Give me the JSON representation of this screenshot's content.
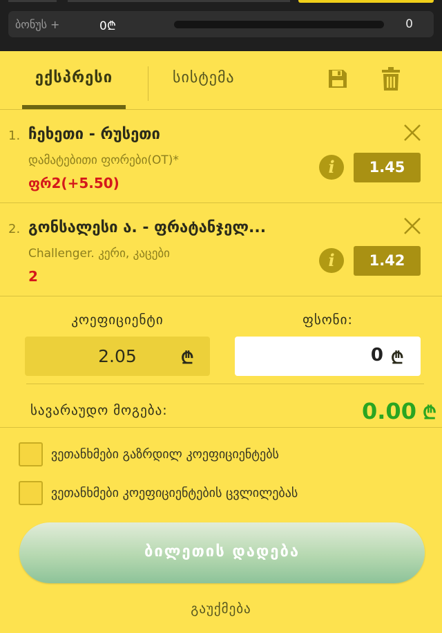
{
  "header": {
    "bonus_label": "ბონუს +",
    "bonus_amount": "0₾",
    "bonus_count": "0"
  },
  "tabs": [
    {
      "label": "ექსპრესი",
      "active": true
    },
    {
      "label": "სისტემა",
      "active": false
    }
  ],
  "toolbar": {
    "save_icon": "save-icon",
    "trash_icon": "trash-icon"
  },
  "bets": [
    {
      "number": "1.",
      "title": "ჩეხეთი - რუსეთი",
      "market": "დამატებითი ფორები(OT)*",
      "pick": "ფრ2(+5.50)",
      "odds": "1.45",
      "info_glyph": "i"
    },
    {
      "number": "2.",
      "title": "გონსალესი ა. - ფრატანჯელ...",
      "market": "Challenger. კერი, კაცები",
      "pick": "2",
      "odds": "1.42",
      "info_glyph": "i"
    }
  ],
  "summary": {
    "coef_label": "კოეფიციენტი",
    "coef_value": "2.05",
    "stake_label": "ფსონი:",
    "stake_value": "0",
    "currency": "₾",
    "win_label": "სავარაუდო მოგება:",
    "win_value": "0.00"
  },
  "checkboxes": [
    {
      "label": "ვეთანხმები გაზრდილ კოეფიციენტებს",
      "checked": false
    },
    {
      "label": "ვეთანხმები კოეფიციენტების ცვლილებას",
      "checked": false
    }
  ],
  "actions": {
    "place_bet": "ბილეთის დადება",
    "cancel": "გაუქმება"
  },
  "colors": {
    "background": "#fde24f",
    "odds_box": "#a99113",
    "pick_red": "#d4181b",
    "win_green": "#2aa521"
  }
}
